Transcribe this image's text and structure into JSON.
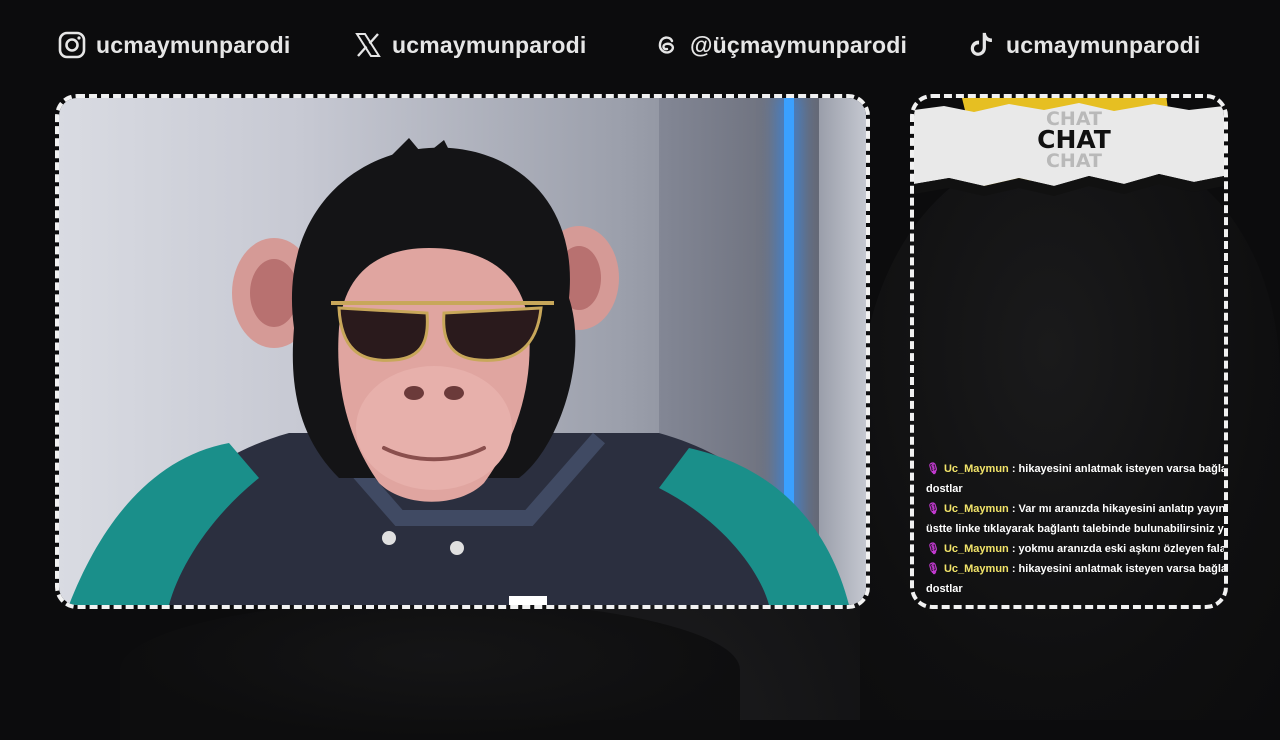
{
  "social": [
    {
      "platform": "instagram",
      "icon": "instagram-icon",
      "handle": "ucmaymunparodi"
    },
    {
      "platform": "x",
      "icon": "x-icon",
      "handle": "ucmaymunparodi"
    },
    {
      "platform": "threads",
      "icon": "threads-icon",
      "handle": "@üçmaymunparodi"
    },
    {
      "platform": "tiktok",
      "icon": "tiktok-icon",
      "handle": "ucmaymunparodi"
    }
  ],
  "chat": {
    "header_word": "CHAT",
    "messages": [
      {
        "user": "Uc_Maymun",
        "line1": "hikayesini anlatmak isteyen varsa bağlantı linkini",
        "line2": "dostlar"
      },
      {
        "user": "Uc_Maymun",
        "line1": "Var mı aranızda hikayesini anlatıp yayına destek",
        "line2": "üstte linke tıklayarak bağlantı talebinde bulunabilirsiniz yayına ba"
      },
      {
        "user": "Uc_Maymun",
        "line1": "yokmu aranızda eski aşkını özleyen falan anlat l",
        "line2": ""
      },
      {
        "user": "Uc_Maymun",
        "line1": "hikayesini anlatmak isteyen varsa bağlantı linkini",
        "line2": "dostlar"
      }
    ]
  },
  "colors": {
    "background": "#0c0c0d",
    "frame_border": "#f1f1f1",
    "chat_username": "#f2e46a",
    "mic_icon": "#c23ad0",
    "chat_banner_yellow": "#e6bf22",
    "neon_blue": "#3aa0ff"
  }
}
